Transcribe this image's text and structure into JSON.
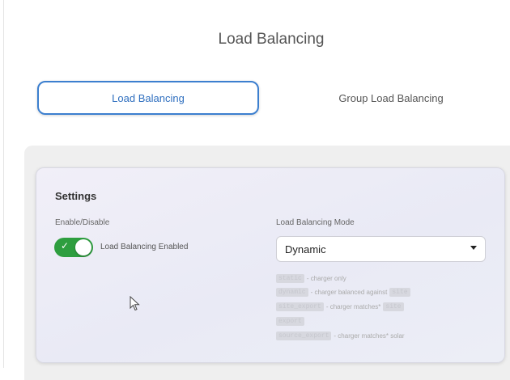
{
  "page": {
    "title": "Load Balancing"
  },
  "tabs": [
    {
      "label": "Load Balancing",
      "active": true
    },
    {
      "label": "Group Load Balancing",
      "active": false
    }
  ],
  "settings": {
    "title": "Settings",
    "enable_label": "Enable/Disable",
    "toggle": {
      "label": "Load Balancing Enabled",
      "checked": true
    },
    "mode_label": "Load Balancing Mode",
    "mode_select": {
      "value": "Dynamic"
    },
    "help": [
      {
        "code": "static",
        "text": "- charger only",
        "code2": ""
      },
      {
        "code": "dynamic",
        "text": "- charger balanced against",
        "code2": "site"
      },
      {
        "code": "site_export",
        "text": "- charger matches*",
        "code2": "site"
      },
      {
        "code": "export",
        "text": "",
        "code2": ""
      },
      {
        "code": "source_export",
        "text": "- charger matches* solar",
        "code2": ""
      }
    ]
  },
  "colors": {
    "accent": "#3c7fcf",
    "toggle_on": "#2e9e3f"
  }
}
